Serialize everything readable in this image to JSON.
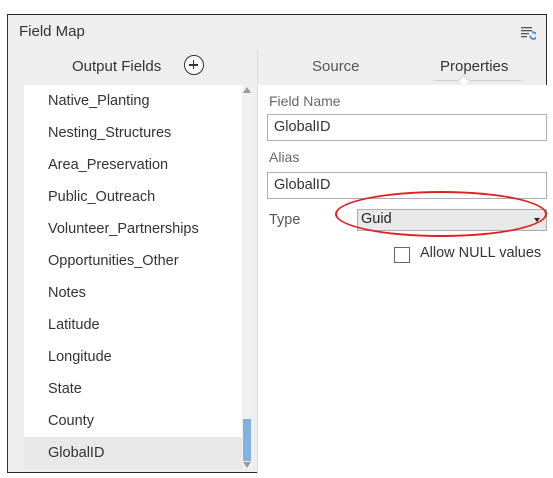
{
  "pane": {
    "title": "Field Map",
    "menu_icon": "list-settings-icon"
  },
  "output_fields": {
    "header": "Output Fields",
    "add_icon": "add-circle-icon",
    "items": [
      {
        "label": "Native_Planting"
      },
      {
        "label": "Nesting_Structures"
      },
      {
        "label": "Area_Preservation"
      },
      {
        "label": "Public_Outreach"
      },
      {
        "label": "Volunteer_Partnerships"
      },
      {
        "label": "Opportunities_Other"
      },
      {
        "label": "Notes"
      },
      {
        "label": "Latitude"
      },
      {
        "label": "Longitude"
      },
      {
        "label": "State"
      },
      {
        "label": "County"
      },
      {
        "label": "GlobalID"
      }
    ],
    "selected": "GlobalID"
  },
  "tabs": {
    "source": "Source",
    "properties": "Properties",
    "active": "Properties"
  },
  "properties": {
    "field_name_label": "Field Name",
    "field_name_value": "GlobalID",
    "alias_label": "Alias",
    "alias_value": "GlobalID",
    "type_label": "Type",
    "type_value": "Guid",
    "allow_null_label": "Allow NULL values",
    "allow_null_checked": false
  },
  "colors": {
    "annotation": "#e02020",
    "scroll_thumb": "#7fb4e0",
    "menu_icon_accent": "#3b82c4"
  }
}
